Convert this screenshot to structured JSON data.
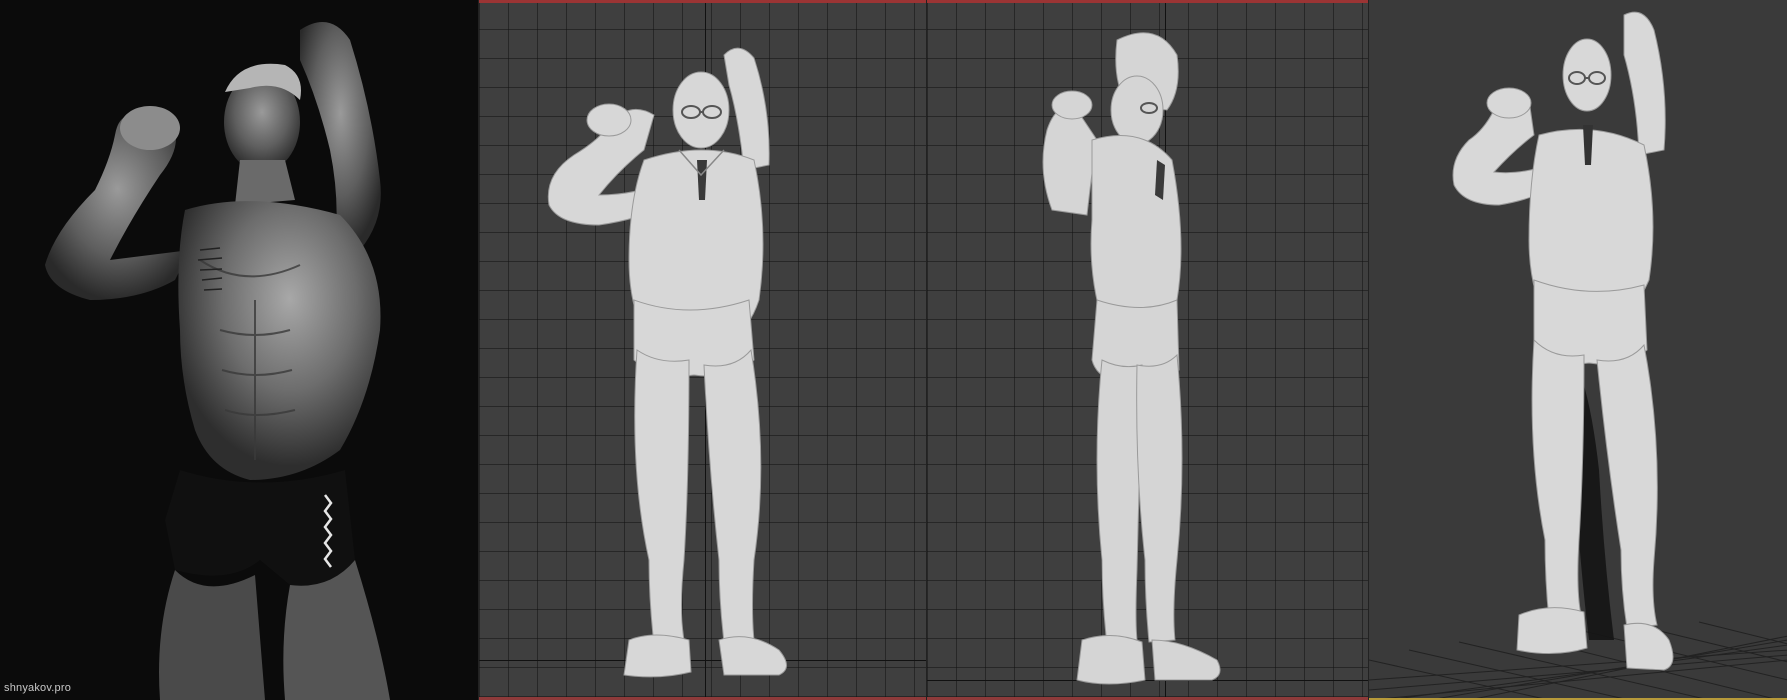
{
  "reference_photo": {
    "watermark": "shnyakov.pro"
  },
  "viewports": {
    "front": {
      "view": "front",
      "grid": true
    },
    "side": {
      "view": "side",
      "grid": true
    },
    "perspective": {
      "view": "perspective",
      "floor_grid": true
    }
  },
  "colors": {
    "viewport_bg": "#3f3f3f",
    "grid_line": "#1e1e1e",
    "model": "#d9d9d9",
    "active_border": "#9b3434",
    "photo_bg": "#0b0b0b"
  }
}
